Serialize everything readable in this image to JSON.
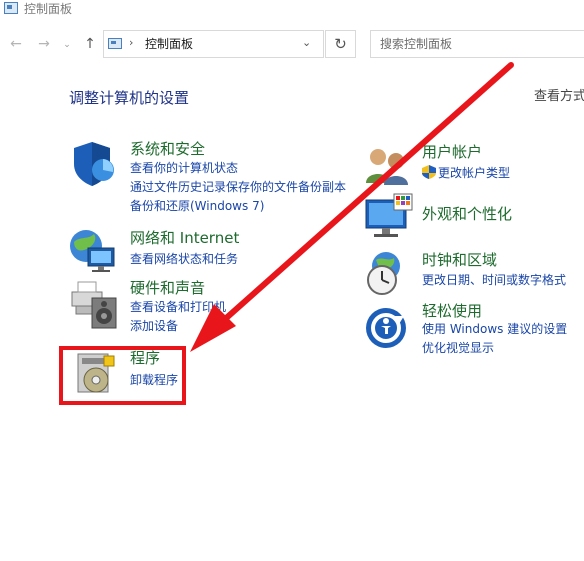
{
  "window": {
    "title": "控制面板"
  },
  "address": {
    "path": "控制面板",
    "separator": "›"
  },
  "search": {
    "placeholder": "搜索控制面板"
  },
  "nav": {
    "back": "←",
    "forward": "→",
    "recent": "⌄",
    "up": "↑",
    "refresh": "↻",
    "dropdown": "⌄"
  },
  "main": {
    "heading": "调整计算机的设置",
    "view_by": "查看方式"
  },
  "categories_left": [
    {
      "title": "系统和安全",
      "links": [
        "查看你的计算机状态",
        "通过文件历史记录保存你的文件备份副本",
        "备份和还原(Windows 7)"
      ],
      "icon": "shield-icon"
    },
    {
      "title": "网络和 Internet",
      "links": [
        "查看网络状态和任务"
      ],
      "icon": "network-globe-icon"
    },
    {
      "title": "硬件和声音",
      "links": [
        "查看设备和打印机",
        "添加设备"
      ],
      "icon": "printer-speaker-icon"
    },
    {
      "title": "程序",
      "links": [
        "卸载程序"
      ],
      "icon": "programs-disc-icon"
    }
  ],
  "categories_right": [
    {
      "title": "用户帐户",
      "links": [
        "更改帐户类型"
      ],
      "icon": "users-icon"
    },
    {
      "title": "外观和个性化",
      "links": [],
      "icon": "monitor-palette-icon"
    },
    {
      "title": "时钟和区域",
      "links": [
        "更改日期、时间或数字格式"
      ],
      "icon": "clock-globe-icon"
    },
    {
      "title": "轻松使用",
      "links": [
        "使用 Windows 建议的设置",
        "优化视觉显示"
      ],
      "icon": "ease-of-access-icon"
    }
  ],
  "colors": {
    "annotation_red": "#e8151b",
    "title_green": "#1e6b2e",
    "link_blue": "#1a46a8",
    "heading_blue": "#1e3287"
  }
}
